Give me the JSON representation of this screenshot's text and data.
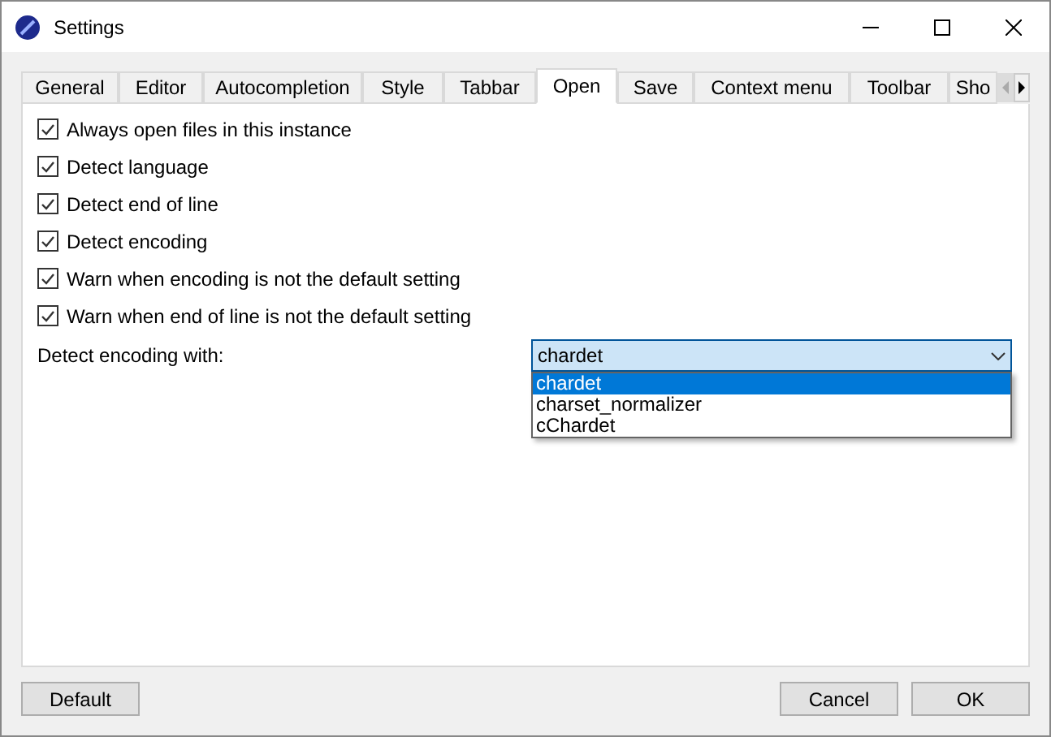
{
  "window": {
    "title": "Settings"
  },
  "tabs": [
    {
      "label": "General",
      "selected": false
    },
    {
      "label": "Editor",
      "selected": false
    },
    {
      "label": "Autocompletion",
      "selected": false
    },
    {
      "label": "Style",
      "selected": false
    },
    {
      "label": "Tabbar",
      "selected": false
    },
    {
      "label": "Open",
      "selected": true
    },
    {
      "label": "Save",
      "selected": false
    },
    {
      "label": "Context menu",
      "selected": false
    },
    {
      "label": "Toolbar",
      "selected": false
    },
    {
      "label": "Sho",
      "selected": false
    }
  ],
  "options": [
    {
      "label": "Always open files in this instance",
      "checked": true
    },
    {
      "label": "Detect language",
      "checked": true
    },
    {
      "label": "Detect end of line",
      "checked": true
    },
    {
      "label": "Detect encoding",
      "checked": true
    },
    {
      "label": "Warn when encoding is not the default setting",
      "checked": true
    },
    {
      "label": "Warn when end of line is not the default setting",
      "checked": true
    }
  ],
  "encoding": {
    "label": "Detect encoding with:",
    "value": "chardet",
    "expanded": true,
    "items": [
      {
        "label": "chardet",
        "selected": true
      },
      {
        "label": "charset_normalizer",
        "selected": false
      },
      {
        "label": "cChardet",
        "selected": false
      }
    ]
  },
  "buttons": {
    "left": [
      "Default"
    ],
    "right": [
      "Cancel",
      "OK"
    ]
  }
}
